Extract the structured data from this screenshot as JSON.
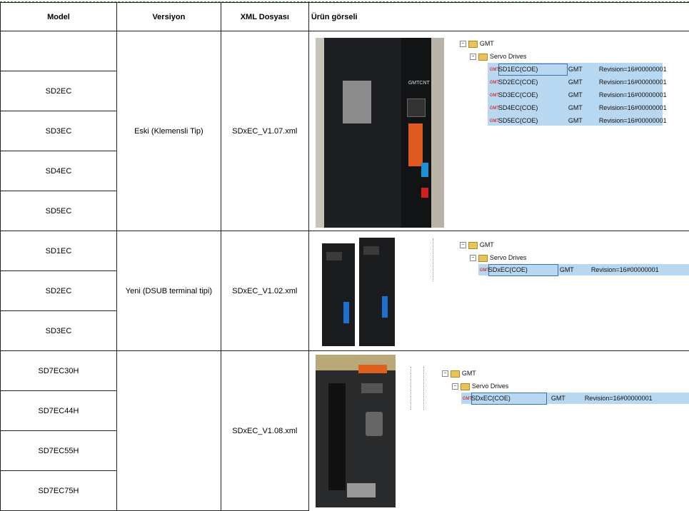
{
  "headers": {
    "model": "Model",
    "version": "Versiyon",
    "xml": "XML Dosyası",
    "image": "Ürün görseli"
  },
  "groups": [
    {
      "models": [
        "",
        "SD2EC",
        "SD3EC",
        "SD4EC",
        "SD5EC"
      ],
      "version": "Eski (Klemensli Tip)",
      "xml": "SDxEC_V1.07.xml"
    },
    {
      "models": [
        "SD1EC",
        "SD2EC",
        "SD3EC"
      ],
      "version": "Yeni (DSUB terminal tipi)",
      "xml": "SDxEC_V1.02.xml"
    },
    {
      "models": [
        "SD7EC30H",
        "SD7EC44H",
        "SD7EC55H",
        "SD7EC75H"
      ],
      "version": "",
      "xml": "SDxEC_V1.08.xml"
    }
  ],
  "trees": [
    {
      "root": "GMT",
      "folder": "Servo Drives",
      "items": [
        {
          "name": "SD1EC(COE)",
          "vendor": "GMT",
          "revision": "Revision=16#00000001"
        },
        {
          "name": "SD2EC(COE)",
          "vendor": "GMT",
          "revision": "Revision=16#00000001"
        },
        {
          "name": "SD3EC(COE)",
          "vendor": "GMT",
          "revision": "Revision=16#00000001"
        },
        {
          "name": "SD4EC(COE)",
          "vendor": "GMT",
          "revision": "Revision=16#00000001"
        },
        {
          "name": "SD5EC(COE)",
          "vendor": "GMT",
          "revision": "Revision=16#00000001"
        }
      ]
    },
    {
      "root": "GMT",
      "folder": "Servo Drives",
      "items": [
        {
          "name": "SDxEC(COE)",
          "vendor": "GMT",
          "revision": "Revision=16#00000001"
        }
      ]
    },
    {
      "root": "GMT",
      "folder": "Servo Drives",
      "items": [
        {
          "name": "SDxEC(COE)",
          "vendor": "GMT",
          "revision": "Revision=16#00000001"
        }
      ]
    }
  ],
  "icons": {
    "tree_item_icon": "gmt-device-icon",
    "folder_icon": "folder-icon",
    "expand_icon": "minus-box-icon"
  },
  "photo_labels": {
    "brand": "GMTCNT"
  }
}
